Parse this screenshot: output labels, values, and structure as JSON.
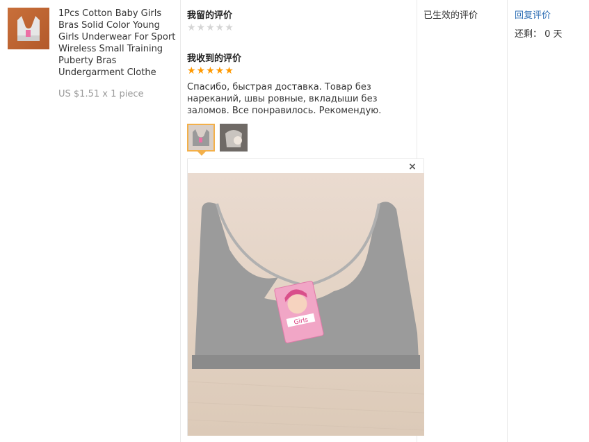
{
  "product": {
    "title": "1Pcs Cotton Baby Girls Bras Solid Color Young Girls Underwear For Sport Wireless Small Training Puberty Bras Undergarment Clothe",
    "price": "US $1.51 x 1 piece"
  },
  "left_review": {
    "heading": "我留的评价",
    "rating": 0,
    "stars": "★★★★★"
  },
  "received_review": {
    "heading": "我收到的评价",
    "rating": 5,
    "stars": "★★★★★",
    "text": "Спасибо, быстрая доставка. Товар без нареканий, швы ровные, вкладыши без заломов. Все понравилось. Рекомендую."
  },
  "preview": {
    "close_label": "×",
    "tag_text": "Girls"
  },
  "status": {
    "label": "已生效的评价"
  },
  "actions": {
    "reply_label": "回复评价",
    "remaining_label": "还剩：",
    "remaining_value": "0 天"
  },
  "colors": {
    "star_active": "#ff9900",
    "star_inactive": "#d5d5d5",
    "link": "#2f6fb5",
    "thumb_selected": "#f3b04a"
  }
}
